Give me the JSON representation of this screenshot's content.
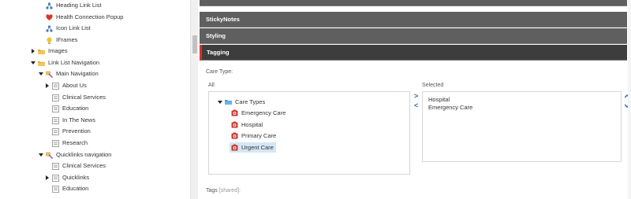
{
  "tree": {
    "items": [
      {
        "label": "Heading Link List",
        "arrow": "none",
        "icon": "link-list-icon"
      },
      {
        "label": "Health Connection Popup",
        "arrow": "none",
        "icon": "popup-icon"
      },
      {
        "label": "Icon Link List",
        "arrow": "none",
        "icon": "link-list-icon"
      },
      {
        "label": "IFrames",
        "arrow": "none",
        "icon": "iframe-icon"
      },
      {
        "label": "Images",
        "arrow": "right",
        "icon": "folder-icon"
      },
      {
        "label": "Link List Navigation",
        "arrow": "down",
        "icon": "folder-icon"
      },
      {
        "label": "Main Navigation",
        "arrow": "down",
        "icon": "navigation-icon"
      },
      {
        "label": "About Us",
        "arrow": "right",
        "icon": "nav-item-icon"
      },
      {
        "label": "Clinical Services",
        "arrow": "none",
        "icon": "nav-item-icon"
      },
      {
        "label": "Education",
        "arrow": "none",
        "icon": "nav-item-icon"
      },
      {
        "label": "In The News",
        "arrow": "none",
        "icon": "nav-item-icon"
      },
      {
        "label": "Prevention",
        "arrow": "none",
        "icon": "nav-item-icon"
      },
      {
        "label": "Research",
        "arrow": "none",
        "icon": "nav-item-icon"
      },
      {
        "label": "Quicklinks navigation",
        "arrow": "down",
        "icon": "navigation-icon"
      },
      {
        "label": "Clinical Services",
        "arrow": "none",
        "icon": "nav-item-icon"
      },
      {
        "label": "Quicklinks",
        "arrow": "right",
        "icon": "nav-item-icon"
      },
      {
        "label": "Education",
        "arrow": "none",
        "icon": "nav-item-icon"
      }
    ]
  },
  "editor": {
    "sections": [
      {
        "label": "StickyNotes",
        "active": false
      },
      {
        "label": "Styling",
        "active": false
      },
      {
        "label": "Tagging",
        "active": true
      }
    ],
    "care_type": {
      "label": "Care Type:",
      "all_label": "All",
      "selected_label": "Selected",
      "root": "Care Types",
      "options": [
        {
          "label": "Emergency Care",
          "highlighted": false
        },
        {
          "label": "Hospital",
          "highlighted": false
        },
        {
          "label": "Primary Care",
          "highlighted": false
        },
        {
          "label": "Urgent Care",
          "highlighted": true
        }
      ],
      "selected": [
        "Hospital",
        "Emergency Care"
      ],
      "add_glyph": ">",
      "remove_glyph": "<"
    },
    "tags": {
      "label": "Tags",
      "suffix": "[shared]:"
    }
  },
  "colors": {
    "section_bg": "#5f5f5f",
    "section_active_bg": "#3d3d3d",
    "accent_red": "#d8322a",
    "arrow_blue": "#2a6ebb",
    "highlight": "#d4e6f5"
  }
}
